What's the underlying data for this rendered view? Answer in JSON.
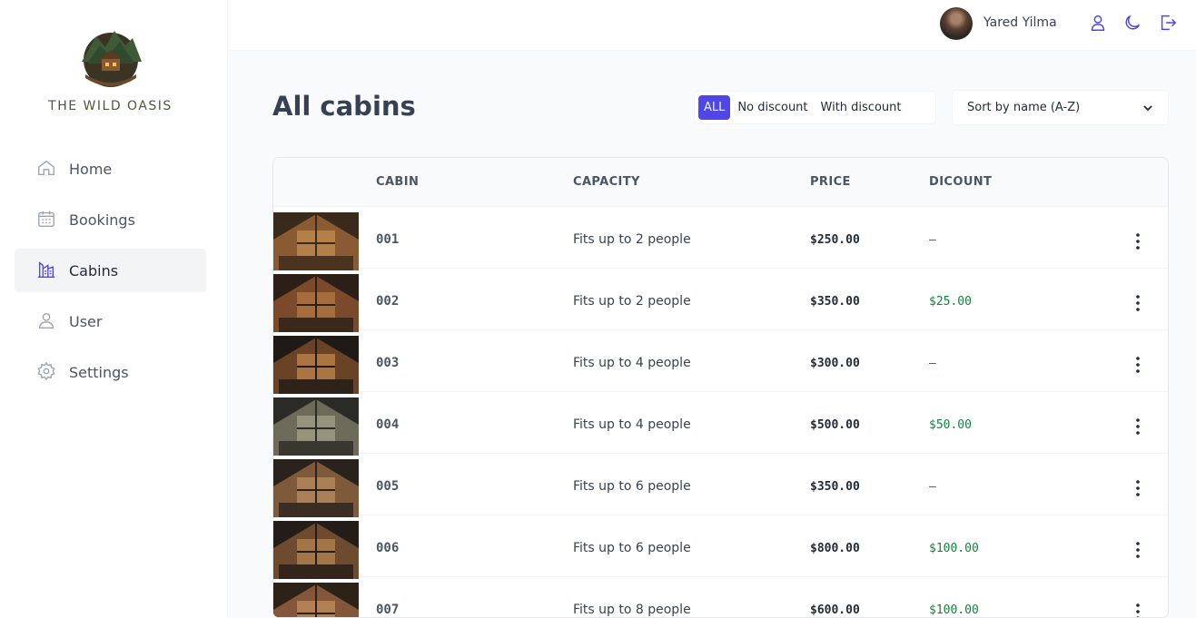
{
  "brand": {
    "name": "THE WILD OASIS"
  },
  "nav": [
    {
      "label": "Home",
      "icon": "home-icon"
    },
    {
      "label": "Bookings",
      "icon": "calendar-icon"
    },
    {
      "label": "Cabins",
      "icon": "cabins-icon",
      "active": true
    },
    {
      "label": "User",
      "icon": "user-icon"
    },
    {
      "label": "Settings",
      "icon": "gear-icon"
    }
  ],
  "header": {
    "user_name": "Yared Yilma"
  },
  "page": {
    "title": "All cabins"
  },
  "filter": {
    "all": "ALL",
    "no_discount": "No discount",
    "with_discount": "With discount",
    "active": "ALL"
  },
  "sort": {
    "selected": "Sort by name (A-Z)"
  },
  "table": {
    "headers": [
      "",
      "CABIN",
      "CAPACITY",
      "PRICE",
      "DICOUNT",
      ""
    ],
    "rows": [
      {
        "name": "001",
        "capacity": "Fits up to 2 people",
        "price": "$250.00",
        "discount": "—"
      },
      {
        "name": "002",
        "capacity": "Fits up to 2 people",
        "price": "$350.00",
        "discount": "$25.00"
      },
      {
        "name": "003",
        "capacity": "Fits up to 4 people",
        "price": "$300.00",
        "discount": "—"
      },
      {
        "name": "004",
        "capacity": "Fits up to 4 people",
        "price": "$500.00",
        "discount": "$50.00"
      },
      {
        "name": "005",
        "capacity": "Fits up to 6 people",
        "price": "$350.00",
        "discount": "—"
      },
      {
        "name": "006",
        "capacity": "Fits up to 6 people",
        "price": "$800.00",
        "discount": "$100.00"
      },
      {
        "name": "007",
        "capacity": "Fits up to 8 people",
        "price": "$600.00",
        "discount": "$100.00"
      }
    ]
  },
  "colors": {
    "accent": "#4f46e5",
    "discount": "#15803d",
    "brand_green": "#4d5a3a"
  }
}
